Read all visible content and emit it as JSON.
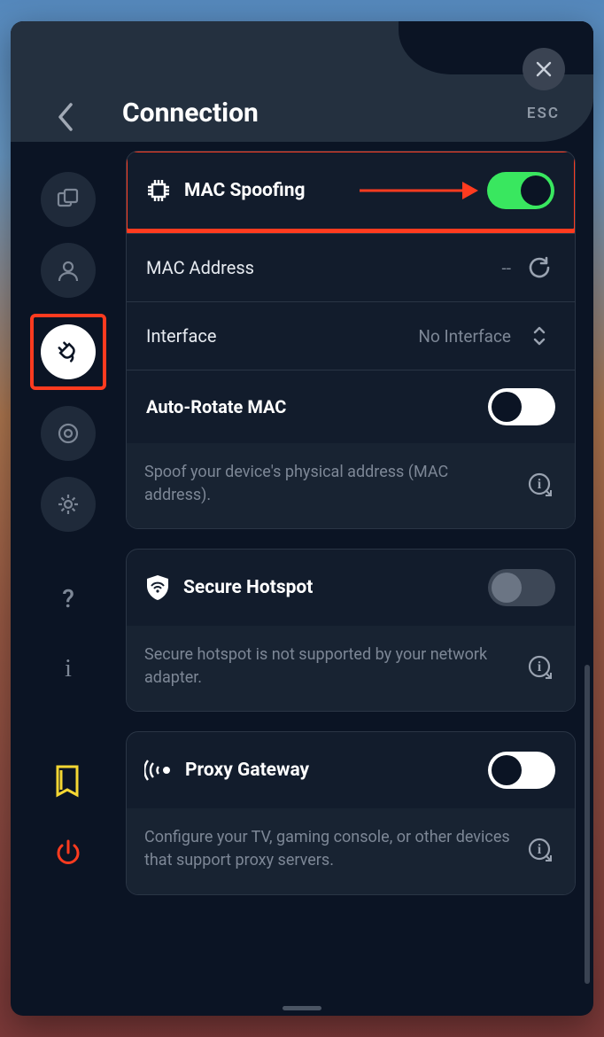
{
  "header": {
    "title": "Connection",
    "esc_label": "ESC"
  },
  "sidebar": {
    "items": [
      {
        "name": "dashboard-icon"
      },
      {
        "name": "user-icon"
      },
      {
        "name": "connection-icon",
        "active": true
      },
      {
        "name": "target-icon"
      },
      {
        "name": "gear-icon"
      },
      {
        "name": "help-icon"
      },
      {
        "name": "info-icon"
      }
    ]
  },
  "sections": {
    "mac_spoofing": {
      "title": "MAC Spoofing",
      "toggle_on": true,
      "mac_address_label": "MAC Address",
      "mac_address_value": "--",
      "interface_label": "Interface",
      "interface_value": "No Interface",
      "auto_rotate_label": "Auto-Rotate MAC",
      "auto_rotate_on": false,
      "footer": "Spoof your device's physical address (MAC address)."
    },
    "secure_hotspot": {
      "title": "Secure Hotspot",
      "toggle_on": false,
      "footer": "Secure hotspot is not supported by your network adapter."
    },
    "proxy_gateway": {
      "title": "Proxy Gateway",
      "toggle_on": false,
      "footer": "Configure your TV, gaming console, or other devices that support proxy servers."
    }
  },
  "colors": {
    "accent_highlight": "#ff3b1f",
    "toggle_on": "#39e75f"
  }
}
